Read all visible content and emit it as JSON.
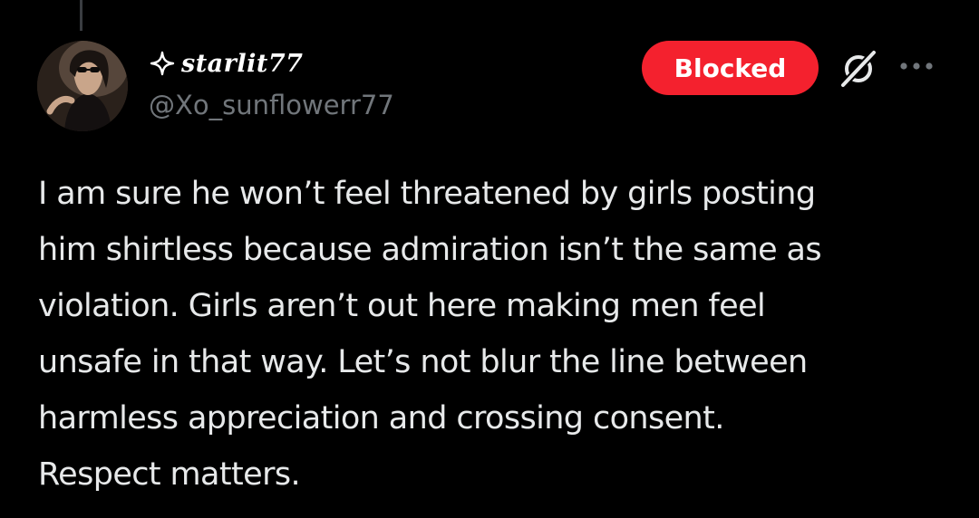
{
  "post": {
    "display_name": "starlit77",
    "handle": "@Xo_sunflowerr77",
    "blocked_label": "Blocked",
    "text": "I am sure he won’t feel threatened by girls posting\nhim shirtless because admiration isn’t the same as\nviolation. Girls aren’t out here making men feel\nunsafe in that way. Let’s not blur the line between\nharmless appreciation and crossing consent.\nRespect matters."
  },
  "icons": {
    "name_prefix": "sparkle-icon",
    "grok": "grok-icon",
    "more": "more-icon"
  },
  "colors": {
    "background": "#000000",
    "text": "#e7e9ea",
    "handle": "#71767b",
    "blocked": "#f4212e"
  }
}
